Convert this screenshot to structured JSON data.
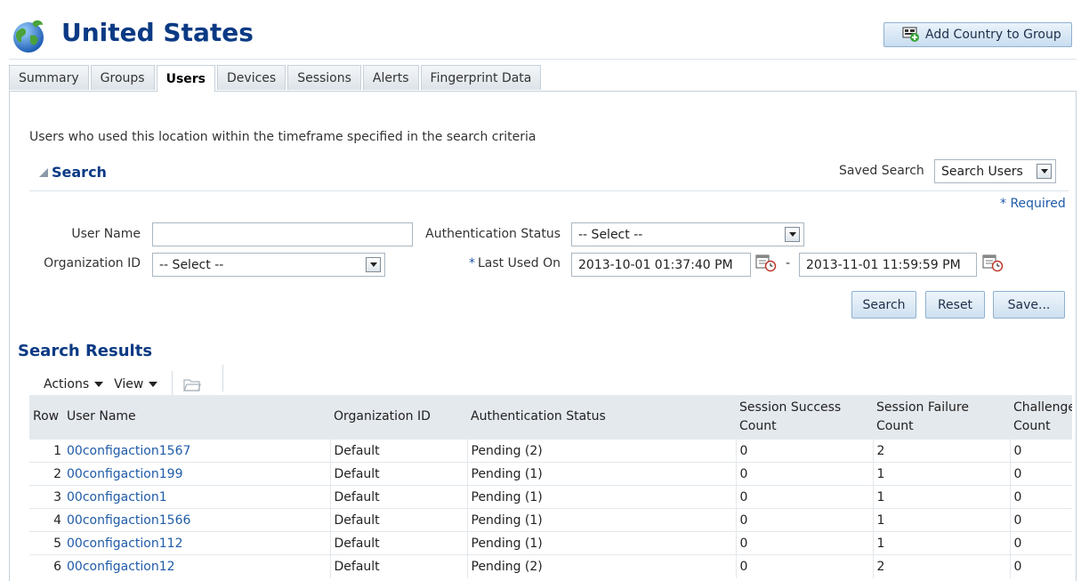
{
  "header": {
    "title": "United States",
    "add_button": "Add Country to Group"
  },
  "tabs": [
    {
      "label": "Summary"
    },
    {
      "label": "Groups"
    },
    {
      "label": "Users",
      "active": true
    },
    {
      "label": "Devices"
    },
    {
      "label": "Sessions"
    },
    {
      "label": "Alerts"
    },
    {
      "label": "Fingerprint Data"
    }
  ],
  "description": "Users who used this location within the timeframe specified in the search criteria",
  "search": {
    "title": "Search",
    "saved_search_label": "Saved Search",
    "saved_search_value": "Search Users",
    "required_note": "* Required",
    "user_name_label": "User Name",
    "user_name_value": "",
    "org_id_label": "Organization ID",
    "org_id_value": "-- Select --",
    "auth_status_label": "Authentication Status",
    "auth_status_value": "-- Select --",
    "last_used_star": "*",
    "last_used_label": "Last Used On",
    "date_from": "2013-10-01 01:37:40 PM",
    "date_separator": "-",
    "date_to": "2013-11-01 11:59:59 PM",
    "buttons": {
      "search": "Search",
      "reset": "Reset",
      "save": "Save..."
    }
  },
  "results": {
    "title": "Search Results",
    "actions_menu": "Actions",
    "view_menu": "View",
    "columns": [
      "Row",
      "User Name",
      "Organization ID",
      "Authentication Status",
      "Session Success Count",
      "Session Failure Count",
      "Challenge Count"
    ],
    "column_lines": {
      "session_success": [
        "Session Success",
        "Count"
      ],
      "session_failure": [
        "Session Failure",
        "Count"
      ],
      "challenge": [
        "Challenge",
        "Count"
      ]
    },
    "rows": [
      {
        "row": "1",
        "user": "00configaction1567",
        "org": "Default",
        "status": "Pending (2)",
        "success": "0",
        "failure": "2",
        "challenge": "0"
      },
      {
        "row": "2",
        "user": "00configaction199",
        "org": "Default",
        "status": "Pending (1)",
        "success": "0",
        "failure": "1",
        "challenge": "0"
      },
      {
        "row": "3",
        "user": "00configaction1",
        "org": "Default",
        "status": "Pending (1)",
        "success": "0",
        "failure": "1",
        "challenge": "0"
      },
      {
        "row": "4",
        "user": "00configaction1566",
        "org": "Default",
        "status": "Pending (1)",
        "success": "0",
        "failure": "1",
        "challenge": "0"
      },
      {
        "row": "5",
        "user": "00configaction112",
        "org": "Default",
        "status": "Pending (1)",
        "success": "0",
        "failure": "1",
        "challenge": "0"
      },
      {
        "row": "6",
        "user": "00configaction12",
        "org": "Default",
        "status": "Pending (2)",
        "success": "0",
        "failure": "2",
        "challenge": "0"
      }
    ]
  },
  "colors": {
    "title_blue": "#0b3a84",
    "link_blue": "#1f5ba8",
    "header_bg": "#e4e9ee"
  },
  "icons": [
    "globe-icon",
    "add-to-group-icon",
    "collapse-triangle-icon",
    "calendar-clock-icon",
    "folder-icon",
    "dropdown-arrow-icon"
  ]
}
